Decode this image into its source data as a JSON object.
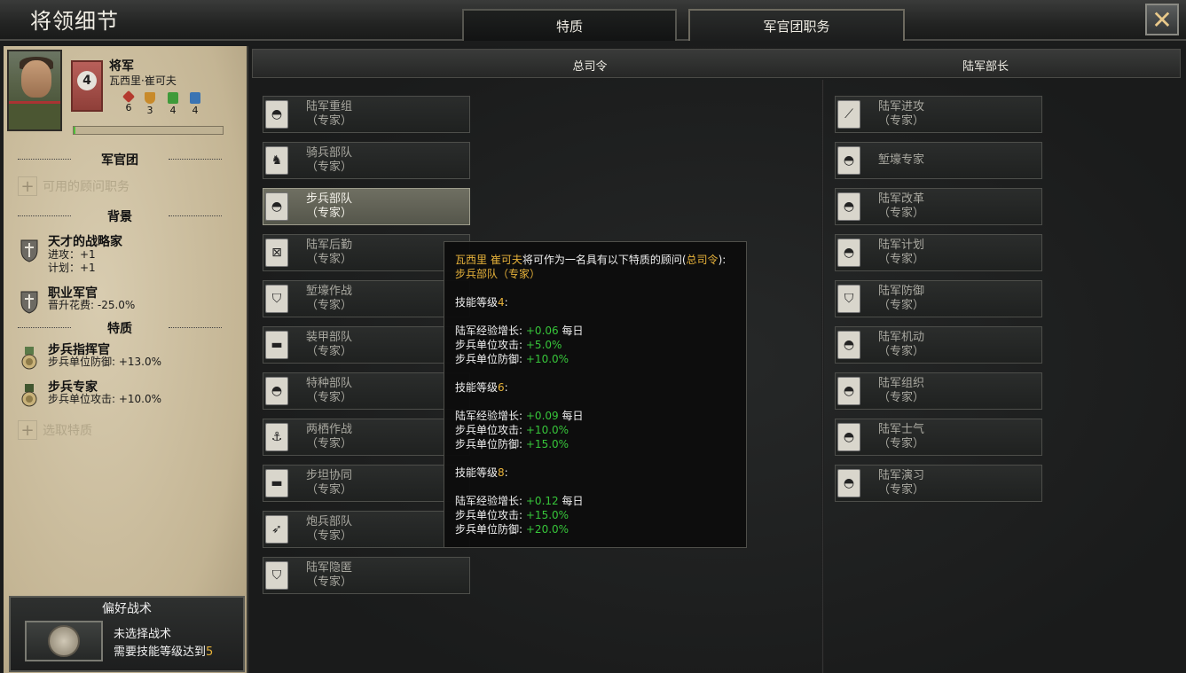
{
  "window": {
    "title": "将领细节",
    "close_icon": "close-icon"
  },
  "tabs": [
    {
      "label": "特质"
    },
    {
      "label": "军官团职务"
    }
  ],
  "general": {
    "rank_level": "4",
    "rank": "将军",
    "name": "瓦西里·崔可夫",
    "stats": [
      {
        "icon": "attack-icon",
        "value": "6",
        "color": "#b43a2e"
      },
      {
        "icon": "defense-icon",
        "value": "3",
        "color": "#c88a2a"
      },
      {
        "icon": "planning-icon",
        "value": "4",
        "color": "#3f9a3a"
      },
      {
        "icon": "logistics-icon",
        "value": "4",
        "color": "#3a74b3"
      }
    ],
    "xp_progress": 0.01
  },
  "left": {
    "corps_title": "军官团",
    "advisor_slot": "可用的顾问职务",
    "background_title": "背景",
    "background": [
      {
        "name": "天才的战略家",
        "lines": [
          "进攻：+1",
          "计划：+1"
        ]
      },
      {
        "name": "职业军官",
        "lines": [
          "晋升花费: -25.0%"
        ]
      }
    ],
    "traits_title": "特质",
    "traits": [
      {
        "name": "步兵指挥官",
        "lines": [
          "步兵单位防御: +13.0%"
        ]
      },
      {
        "name": "步兵专家",
        "lines": [
          "步兵单位攻击: +10.0%"
        ]
      }
    ],
    "select_trait": "选取特质"
  },
  "tactics": {
    "title": "偏好战术",
    "line1": "未选择战术",
    "line2_prefix": "需要技能等级达到",
    "line2_value": "5"
  },
  "columns": {
    "left": "总司令",
    "right": "陆军部长"
  },
  "commander_roles": [
    {
      "name": "陆军重组",
      "sub": "（专家）",
      "icon": "helmet-icon"
    },
    {
      "name": "骑兵部队",
      "sub": "（专家）",
      "icon": "horse-icon"
    },
    {
      "name": "步兵部队",
      "sub": "（专家）",
      "icon": "helmet-icon",
      "selected": true
    },
    {
      "name": "陆军后勤",
      "sub": "（专家）",
      "icon": "supply-icon"
    },
    {
      "name": "堑壕作战",
      "sub": "（专家）",
      "icon": "shield-icon"
    },
    {
      "name": "装甲部队",
      "sub": "（专家）",
      "icon": "tank-icon"
    },
    {
      "name": "特种部队",
      "sub": "（专家）",
      "icon": "helmet-icon"
    },
    {
      "name": "两栖作战",
      "sub": "（专家）",
      "icon": "anchor-icon"
    },
    {
      "name": "步坦协同",
      "sub": "（专家）",
      "icon": "tank-icon"
    },
    {
      "name": "炮兵部队",
      "sub": "（专家）",
      "icon": "artillery-icon"
    },
    {
      "name": "陆军隐匿",
      "sub": "（专家）",
      "icon": "shield-icon"
    }
  ],
  "minister_roles": [
    {
      "name": "陆军进攻",
      "sub": "（专家）",
      "icon": "sword-icon"
    },
    {
      "name": "堑壕专家",
      "sub": "",
      "icon": "helmet-icon"
    },
    {
      "name": "陆军改革",
      "sub": "（专家）",
      "icon": "helmet-icon"
    },
    {
      "name": "陆军计划",
      "sub": "（专家）",
      "icon": "helmet-icon"
    },
    {
      "name": "陆军防御",
      "sub": "（专家）",
      "icon": "shield-icon"
    },
    {
      "name": "陆军机动",
      "sub": "（专家）",
      "icon": "helmet-icon"
    },
    {
      "name": "陆军组织",
      "sub": "（专家）",
      "icon": "helmet-icon"
    },
    {
      "name": "陆军士气",
      "sub": "（专家）",
      "icon": "helmet-icon"
    },
    {
      "name": "陆军演习",
      "sub": "（专家）",
      "icon": "helmet-icon"
    }
  ],
  "tooltip": {
    "name1": "瓦西里",
    "name2": "崔可夫",
    "intro": "将可作为一名具有以下特质的顾问(",
    "role_type": "总司令",
    "intro_end": "):",
    "role": "步兵部队（专家）",
    "levels": [
      {
        "label": "技能等级",
        "level": "4",
        "xp": "+0.06",
        "xp_suffix": "每日",
        "atk": "+5.0%",
        "def": "+10.0%"
      },
      {
        "label": "技能等级",
        "level": "6",
        "xp": "+0.09",
        "xp_suffix": "每日",
        "atk": "+10.0%",
        "def": "+15.0%"
      },
      {
        "label": "技能等级",
        "level": "8",
        "xp": "+0.12",
        "xp_suffix": "每日",
        "atk": "+15.0%",
        "def": "+20.0%"
      }
    ],
    "xp_label": "陆军经验增长:",
    "atk_label": "步兵单位攻击:",
    "def_label": "步兵单位防御:"
  }
}
